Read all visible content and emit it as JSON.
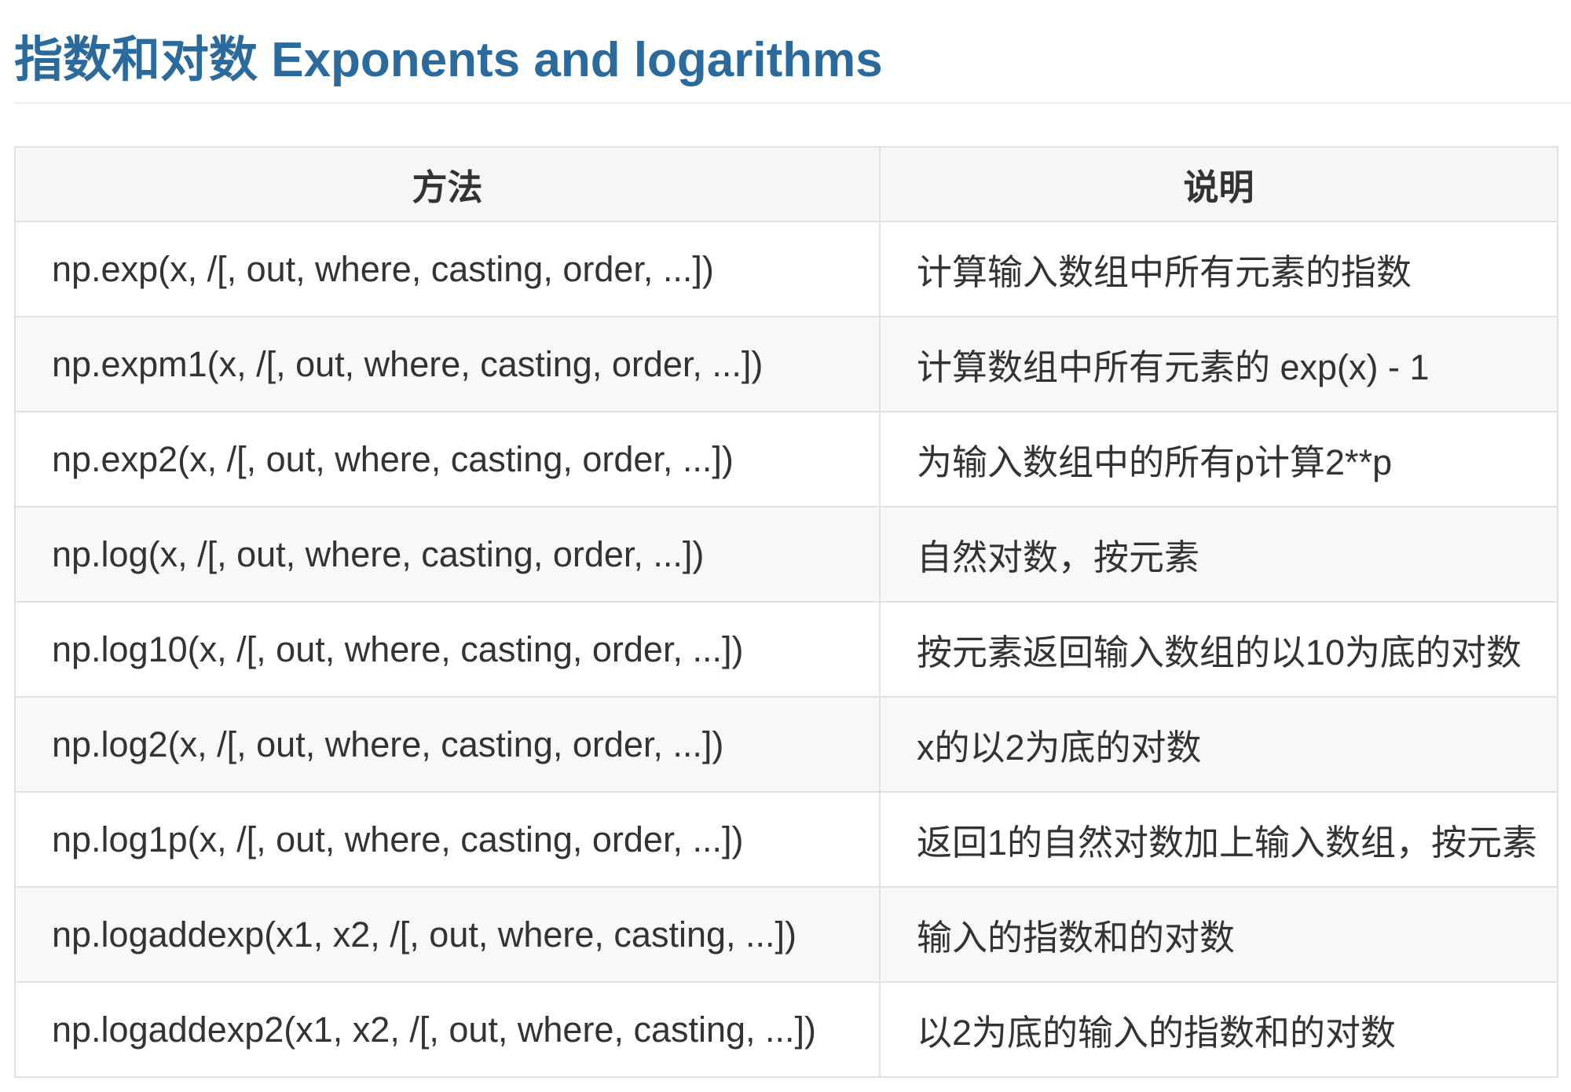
{
  "heading": {
    "title": "指数和对数 Exponents and logarithms"
  },
  "table": {
    "headers": {
      "method": "方法",
      "description": "说明"
    },
    "rows": [
      {
        "method": "np.exp(x, /[, out, where, casting, order, ...])",
        "description": "计算输入数组中所有元素的指数"
      },
      {
        "method": "np.expm1(x, /[, out, where, casting, order, ...])",
        "description": "计算数组中所有元素的 exp(x) - 1"
      },
      {
        "method": "np.exp2(x, /[, out, where, casting, order, ...])",
        "description": "为输入数组中的所有p计算2**p"
      },
      {
        "method": "np.log(x, /[, out, where, casting, order, ...])",
        "description": "自然对数，按元素"
      },
      {
        "method": "np.log10(x, /[, out, where, casting, order, ...])",
        "description": "按元素返回输入数组的以10为底的对数"
      },
      {
        "method": "np.log2(x, /[, out, where, casting, order, ...])",
        "description": "x的以2为底的对数"
      },
      {
        "method": "np.log1p(x, /[, out, where, casting, order, ...])",
        "description": "返回1的自然对数加上输入数组，按元素"
      },
      {
        "method": "np.logaddexp(x1, x2, /[, out, where, casting, ...])",
        "description": "输入的指数和的对数"
      },
      {
        "method": "np.logaddexp2(x1, x2, /[, out, where, casting, ...])",
        "description": "以2为底的输入的指数和的对数"
      }
    ]
  },
  "theme": {
    "title_color": "#2b6a9d",
    "text_color": "#333333",
    "border_color": "#dfe2e5",
    "header_bg": "#f6f6f6",
    "stripe_bg": "#f8f8f8",
    "divider_color": "#eeeeee"
  }
}
